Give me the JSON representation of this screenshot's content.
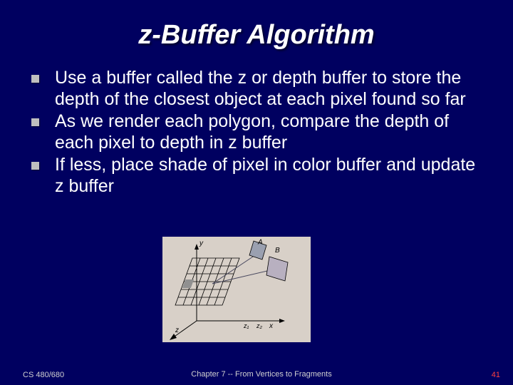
{
  "title": "z-Buffer Algorithm",
  "bullets": [
    "Use a buffer called the z or depth buffer to store the depth of the closest object at each pixel found so far",
    "As we render each polygon, compare the depth of each pixel to depth in z buffer",
    "If less, place shade of pixel in color buffer and update z buffer"
  ],
  "diagram": {
    "labels": {
      "y": "y",
      "x": "x",
      "z": "z",
      "A": "A",
      "B": "B",
      "z1": "z₁",
      "z2": "z₂"
    }
  },
  "footer": {
    "left": "CS 480/680",
    "center": "Chapter 7 -- From Vertices to Fragments",
    "page": "41"
  }
}
